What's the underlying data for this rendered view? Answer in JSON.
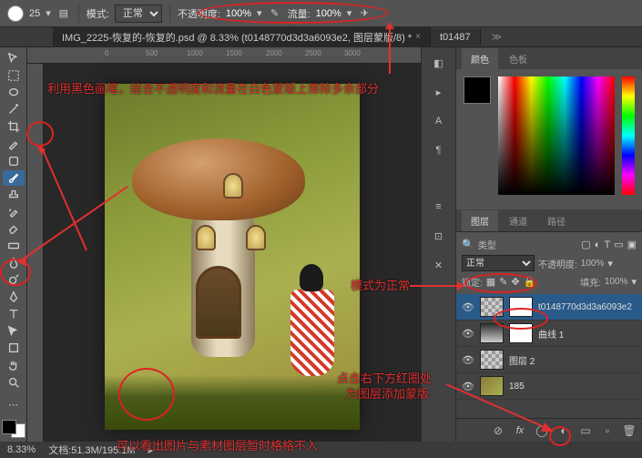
{
  "topbar": {
    "brush_size": "25",
    "mode_label": "模式:",
    "mode_value": "正常",
    "opacity_label": "不透明度:",
    "opacity_value": "100%",
    "flow_label": "流量:",
    "flow_value": "100%"
  },
  "tabs": [
    {
      "label": "IMG_2225-恢复的-恢复的.psd @ 8.33% (t0148770d3d3a6093e2, 图层蒙版/8) *",
      "active": true
    },
    {
      "label": "t01487",
      "active": false
    }
  ],
  "ruler_marks": [
    "0",
    "500",
    "1000",
    "1500",
    "2000",
    "2500",
    "3000"
  ],
  "panel_tabs": {
    "color": "颜色",
    "swatches": "色板"
  },
  "layers_tabs": {
    "layers": "图层",
    "channels": "通道",
    "paths": "路径"
  },
  "layer_opts": {
    "kind": "类型",
    "blend": "正常",
    "opacity_label": "不透明度:",
    "opacity": "100%",
    "lock_label": "锁定:",
    "fill_label": "填充:",
    "fill": "100%"
  },
  "layers": [
    {
      "name": "t0148770d3d3a6093e2",
      "sel": true,
      "mask": true
    },
    {
      "name": "曲线 1",
      "sel": false,
      "adj": true
    },
    {
      "name": "图层 2",
      "sel": false
    },
    {
      "name": "185",
      "sel": false
    }
  ],
  "status": {
    "zoom": "8.33%",
    "docsize": "文档:51.3M/195.1M"
  },
  "annotations": {
    "a1": "利用黑色画笔，结合不透明度和流量在白色蒙版上擦除多余部分",
    "a2": "模式为正常",
    "a3": "点击右下方红圈处",
    "a4": "为图层添加蒙版",
    "a5": "可以看出图片与素材图层暂时格格不入"
  }
}
